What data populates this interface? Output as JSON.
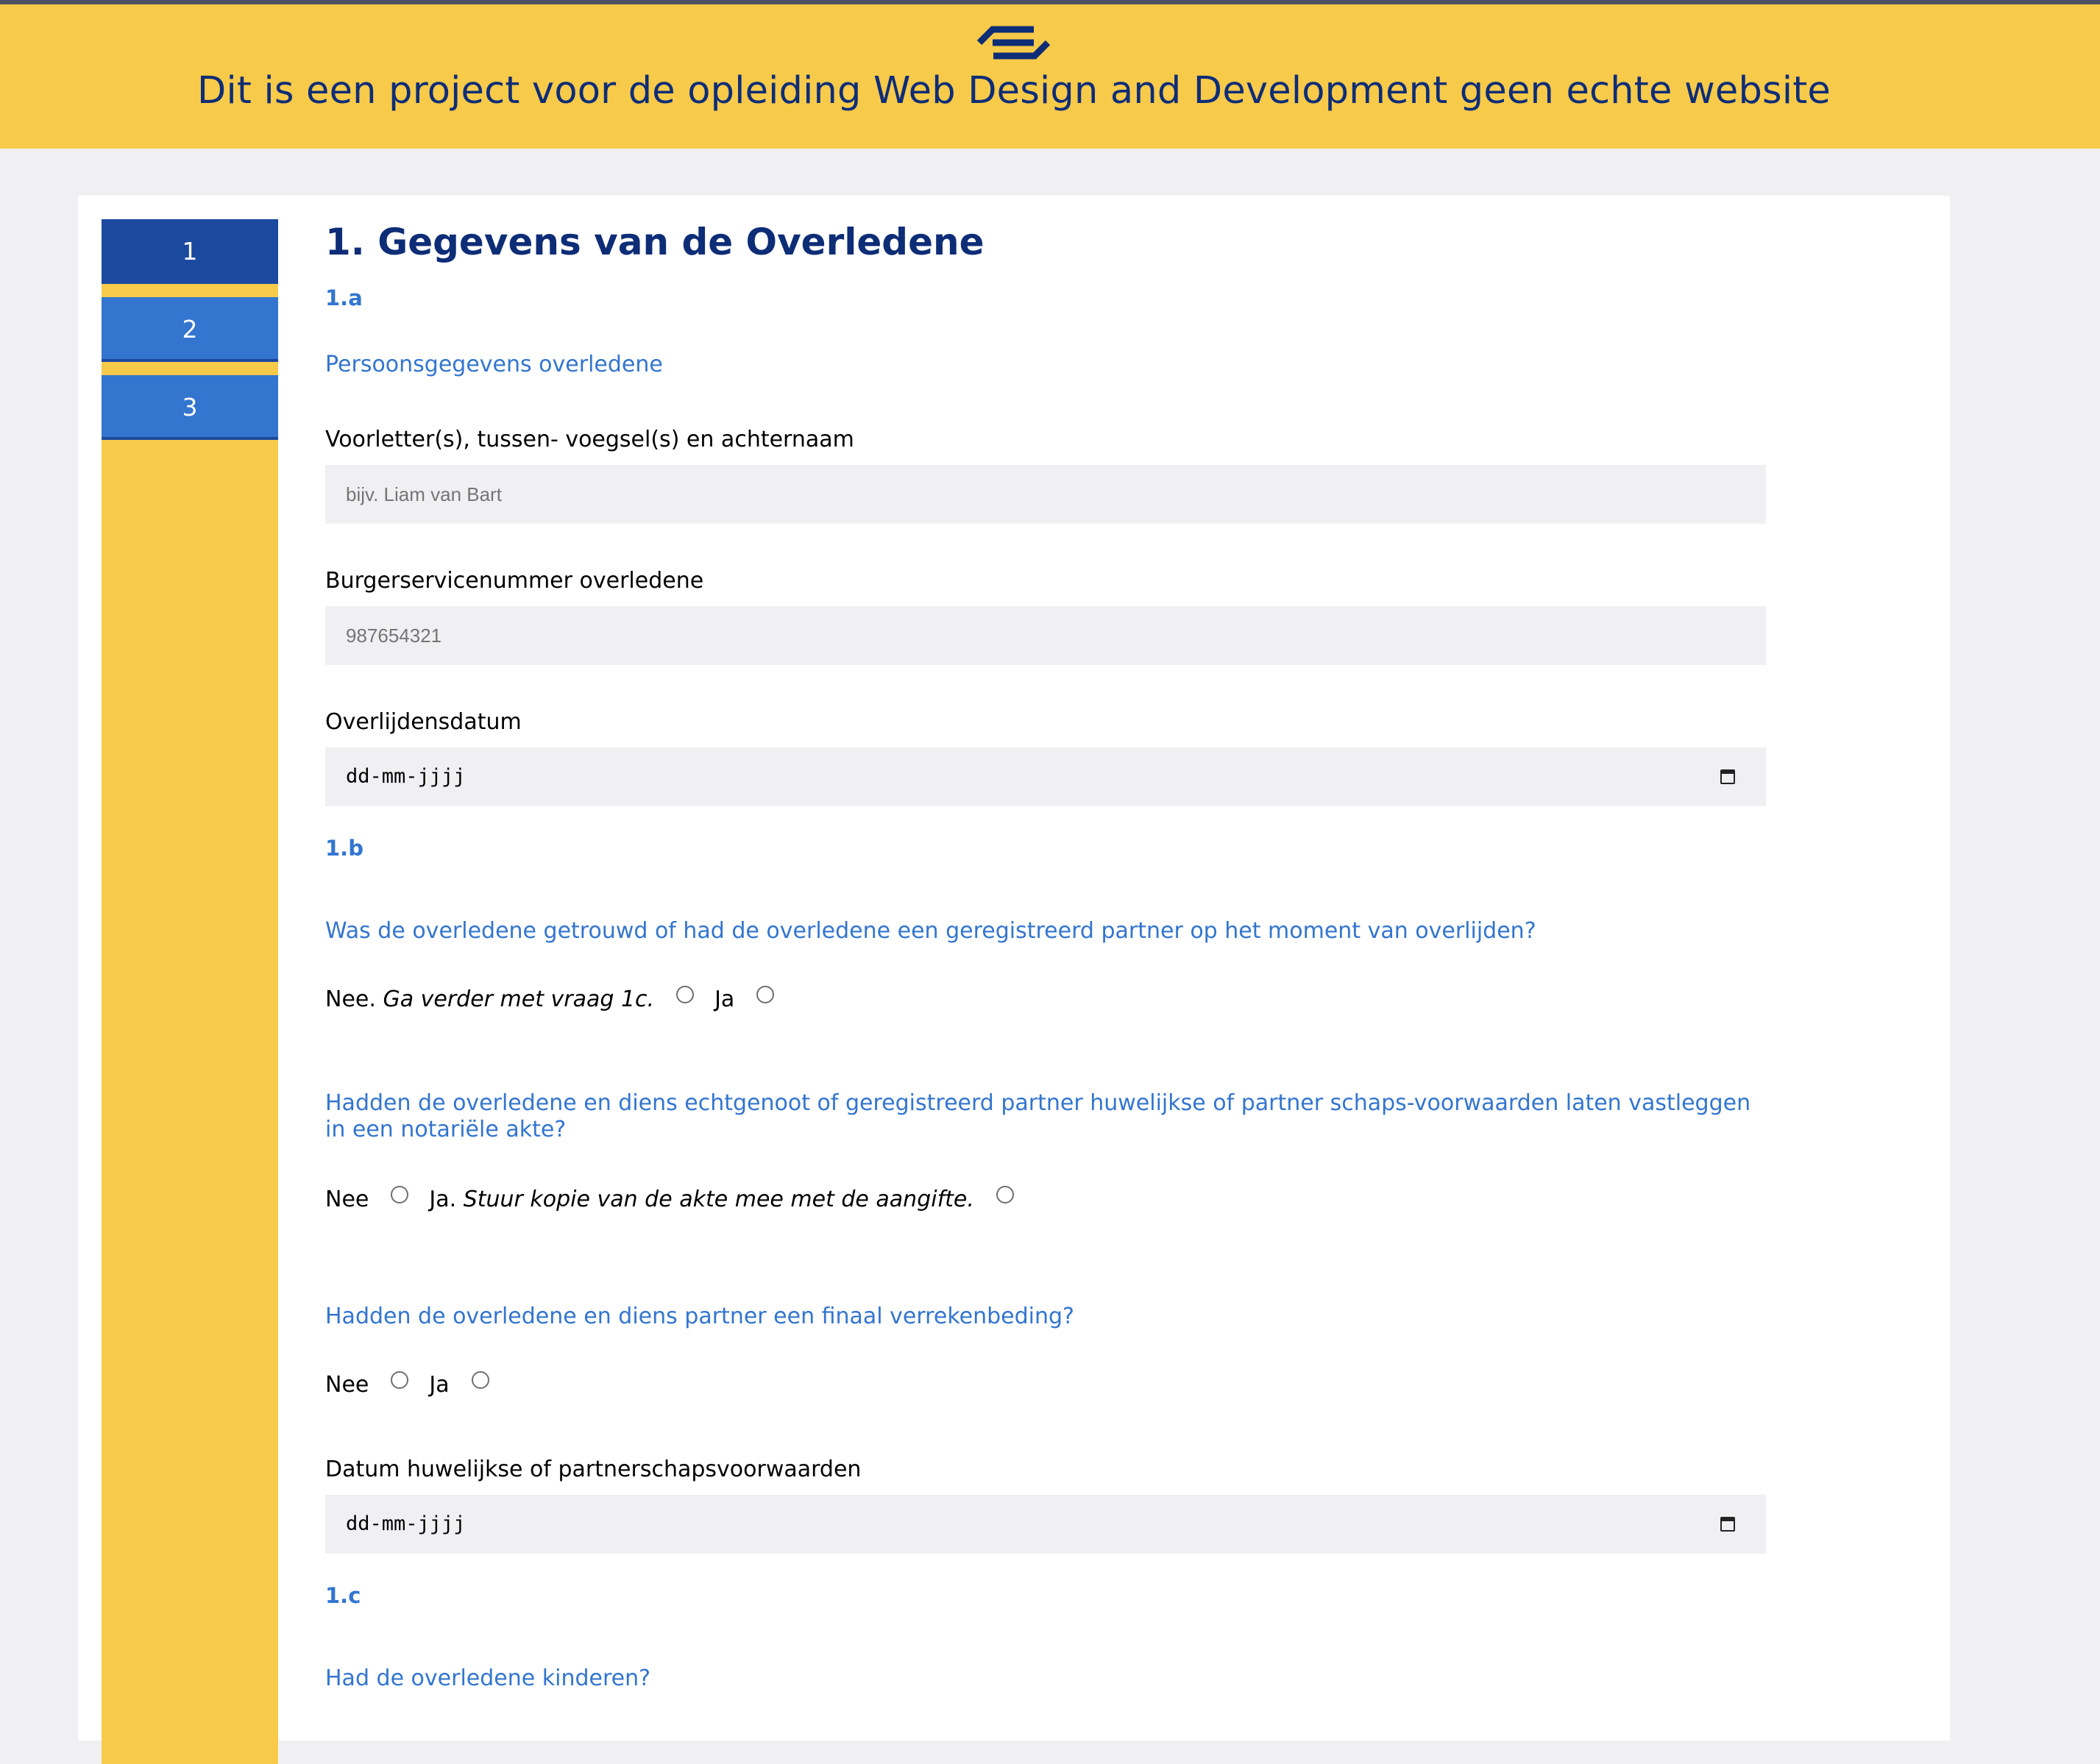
{
  "header": {
    "title": "Dit is een project voor de opleiding Web Design and Development geen echte website",
    "logo_icon": "ns-logo-icon"
  },
  "sidebar": {
    "steps": [
      {
        "label": "1",
        "active": true
      },
      {
        "label": "2",
        "active": false
      },
      {
        "label": "3",
        "active": false
      }
    ]
  },
  "main": {
    "heading": "1. Gegevens van de Overledene",
    "section_a": {
      "label": "1.a",
      "question": "Persoonsgegevens overledene",
      "name_label": "Voorletter(s), tussen- voegsel(s) en achternaam",
      "name_placeholder": "bijv. Liam van Bart",
      "bsn_label": "Burgerservicenummer overledene",
      "bsn_placeholder": "987654321",
      "death_date_label": "Overlijdensdatum",
      "death_date_placeholder": "dd-mm-jjjj"
    },
    "section_b": {
      "label": "1.b",
      "q1": "Was de overledene getrouwd of had de overledene een geregistreerd partner op het moment van overlijden?",
      "q1_opt_no": "Nee.",
      "q1_opt_no_note": "Ga verder met vraag 1c.",
      "q1_opt_yes": "Ja",
      "q2": "Hadden de overledene en diens echtgenoot of geregistreerd partner huwelijkse of partner schaps-voorwaarden laten vastleggen in een notariële akte?",
      "q2_opt_no": "Nee",
      "q2_opt_yes": "Ja.",
      "q2_opt_yes_note": "Stuur kopie van de akte mee met de aangifte.",
      "q3": "Hadden de overledene en diens partner een finaal verrekenbeding?",
      "q3_opt_no": "Nee",
      "q3_opt_yes": "Ja",
      "date_label": "Datum huwelijkse of partnerschapsvoorwaarden",
      "date_placeholder": "dd-mm-jjjj"
    },
    "section_c": {
      "label": "1.c",
      "q1": "Had de overledene kinderen?"
    }
  },
  "colors": {
    "brand_yellow": "#f7ca4a",
    "brand_blue": "#0e2d77",
    "accent_blue": "#3375cf",
    "active_step": "#1c49a0"
  }
}
